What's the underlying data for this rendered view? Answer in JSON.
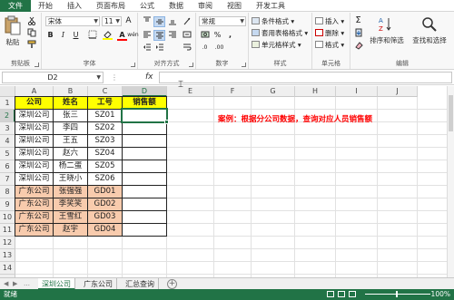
{
  "tabs": [
    "文件",
    "开始",
    "插入",
    "页面布局",
    "公式",
    "数据",
    "审阅",
    "视图",
    "开发工具"
  ],
  "ribbon": {
    "paste_label": "粘贴",
    "clipboard_label": "剪贴板",
    "font_name": "宋体",
    "font_size": "11",
    "font_label": "字体",
    "align_label": "对齐方式",
    "number_format": "常规",
    "number_label": "数字",
    "style_items": [
      "条件格式",
      "套用表格格式",
      "单元格样式"
    ],
    "style_label": "样式",
    "cell_items": [
      "插入",
      "删除",
      "格式"
    ],
    "cell_label": "单元格",
    "sort_label": "排序和筛选",
    "find_label": "查找和选择",
    "edit_label": "编辑",
    "bold": "B",
    "italic": "I",
    "underline": "U",
    "grow_font": "A",
    "shrink_font": "A",
    "wubi": "wén",
    "percent": "%",
    "comma": ",",
    "inc_decimal": ".0",
    "dec_decimal": ".00",
    "sum": "Σ"
  },
  "formula_bar": {
    "name_box": "D2",
    "fx": "fx"
  },
  "columns": [
    "A",
    "B",
    "C",
    "D",
    "E",
    "F",
    "G",
    "H",
    "I",
    "J"
  ],
  "rows": [
    "1",
    "2",
    "3",
    "4",
    "5",
    "6",
    "7",
    "8",
    "9",
    "10",
    "11",
    "12",
    "13",
    "14",
    "15",
    "16"
  ],
  "table": {
    "headers": [
      "公司",
      "姓名",
      "工号",
      "销售额"
    ],
    "body": [
      [
        "深圳公司",
        "张三",
        "SZ01",
        ""
      ],
      [
        "深圳公司",
        "李四",
        "SZ02",
        ""
      ],
      [
        "深圳公司",
        "王五",
        "SZ03",
        ""
      ],
      [
        "深圳公司",
        "赵六",
        "SZ04",
        ""
      ],
      [
        "深圳公司",
        "杨二蛋",
        "SZ05",
        ""
      ],
      [
        "深圳公司",
        "王晓小",
        "SZ06",
        ""
      ],
      [
        "广东公司",
        "张强强",
        "GD01",
        ""
      ],
      [
        "广东公司",
        "李笑笑",
        "GD02",
        ""
      ],
      [
        "广东公司",
        "王雪红",
        "GD03",
        ""
      ],
      [
        "广东公司",
        "赵宇",
        "GD04",
        ""
      ]
    ]
  },
  "note": "案例：根据分公司数据，查询对应人员销售额",
  "sheets": [
    "深圳公司",
    "广东公司",
    "汇总查询"
  ],
  "status": {
    "ready": "就绪",
    "zoom": "100%"
  },
  "colors": {
    "accent": "#217346",
    "header_fill": "#ffff00",
    "group2_fill": "#f8cbad",
    "note": "#ff0000"
  }
}
